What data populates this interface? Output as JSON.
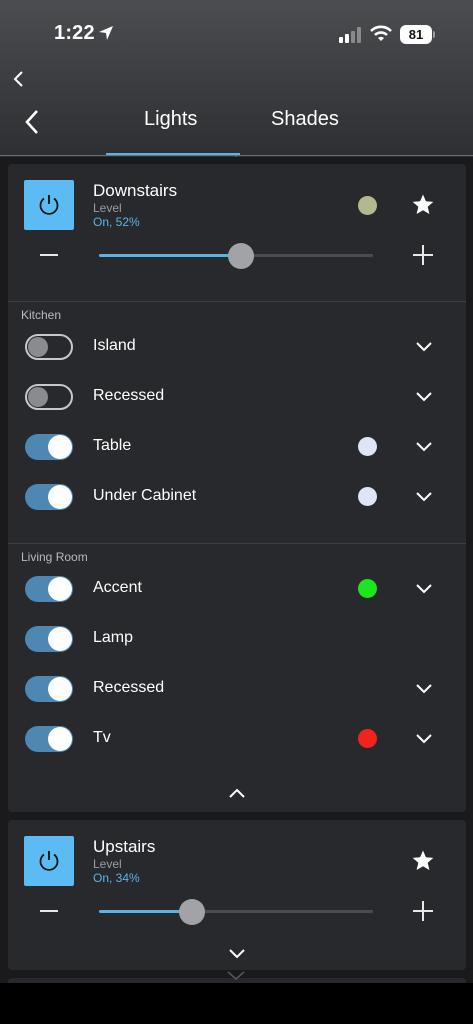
{
  "status_bar": {
    "time": "1:22",
    "battery": "81"
  },
  "tabs": [
    {
      "label": "Lights",
      "active": true
    },
    {
      "label": "Shades",
      "active": false
    }
  ],
  "colors": {
    "accent": "#5ab3e8",
    "power": "#5cbbf2",
    "toggle_on": "#4d87b2",
    "card": "#27292c"
  },
  "groups": [
    {
      "title": "Downstairs",
      "level_label": "Level",
      "status": "On, 52%",
      "level": 52,
      "color_dot": "#b3b98c",
      "rooms": [
        {
          "name": "Kitchen",
          "lights": [
            {
              "label": "Island",
              "on": false,
              "color": null,
              "expandable": true
            },
            {
              "label": "Recessed",
              "on": false,
              "color": null,
              "expandable": true
            },
            {
              "label": "Table",
              "on": true,
              "color": "#dfe4f6",
              "expandable": true
            },
            {
              "label": "Under Cabinet",
              "on": true,
              "color": "#dfe4f6",
              "expandable": true
            }
          ]
        },
        {
          "name": "Living Room",
          "lights": [
            {
              "label": "Accent",
              "on": true,
              "color": "#1ee61e",
              "expandable": true
            },
            {
              "label": "Lamp",
              "on": true,
              "color": null,
              "expandable": false
            },
            {
              "label": "Recessed",
              "on": true,
              "color": null,
              "expandable": true
            },
            {
              "label": "Tv",
              "on": true,
              "color": "#f0241c",
              "expandable": true
            }
          ]
        }
      ]
    },
    {
      "title": "Upstairs",
      "level_label": "Level",
      "status": "On, 34%",
      "level": 34
    }
  ]
}
